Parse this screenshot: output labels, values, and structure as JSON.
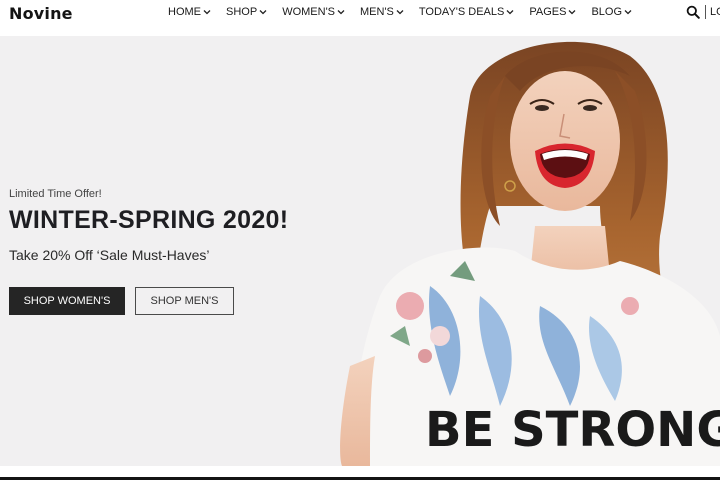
{
  "brand": {
    "logo_text": "Novine"
  },
  "nav": {
    "items": [
      {
        "label": "HOME"
      },
      {
        "label": "SHOP"
      },
      {
        "label": "WOMEN'S"
      },
      {
        "label": "MEN'S"
      },
      {
        "label": "TODAY'S DEALS"
      },
      {
        "label": "PAGES"
      },
      {
        "label": "BLOG"
      }
    ],
    "search_icon": "search-icon",
    "login_label": "LO"
  },
  "hero": {
    "eyebrow": "Limited Time Offer!",
    "headline": "WINTER-SPRING 2020!",
    "subline": "Take 20% Off ‘Sale Must-Haves’",
    "primary_button": "SHOP WOMEN'S",
    "secondary_button": "SHOP MEN'S",
    "shirt_text": "BE STRONG"
  },
  "colors": {
    "hero_background": "#f1f0f1",
    "primary_button_bg": "#252525",
    "text_dark": "#1e1e22",
    "hair": "#9a5a2c",
    "lips": "#d8262e"
  }
}
